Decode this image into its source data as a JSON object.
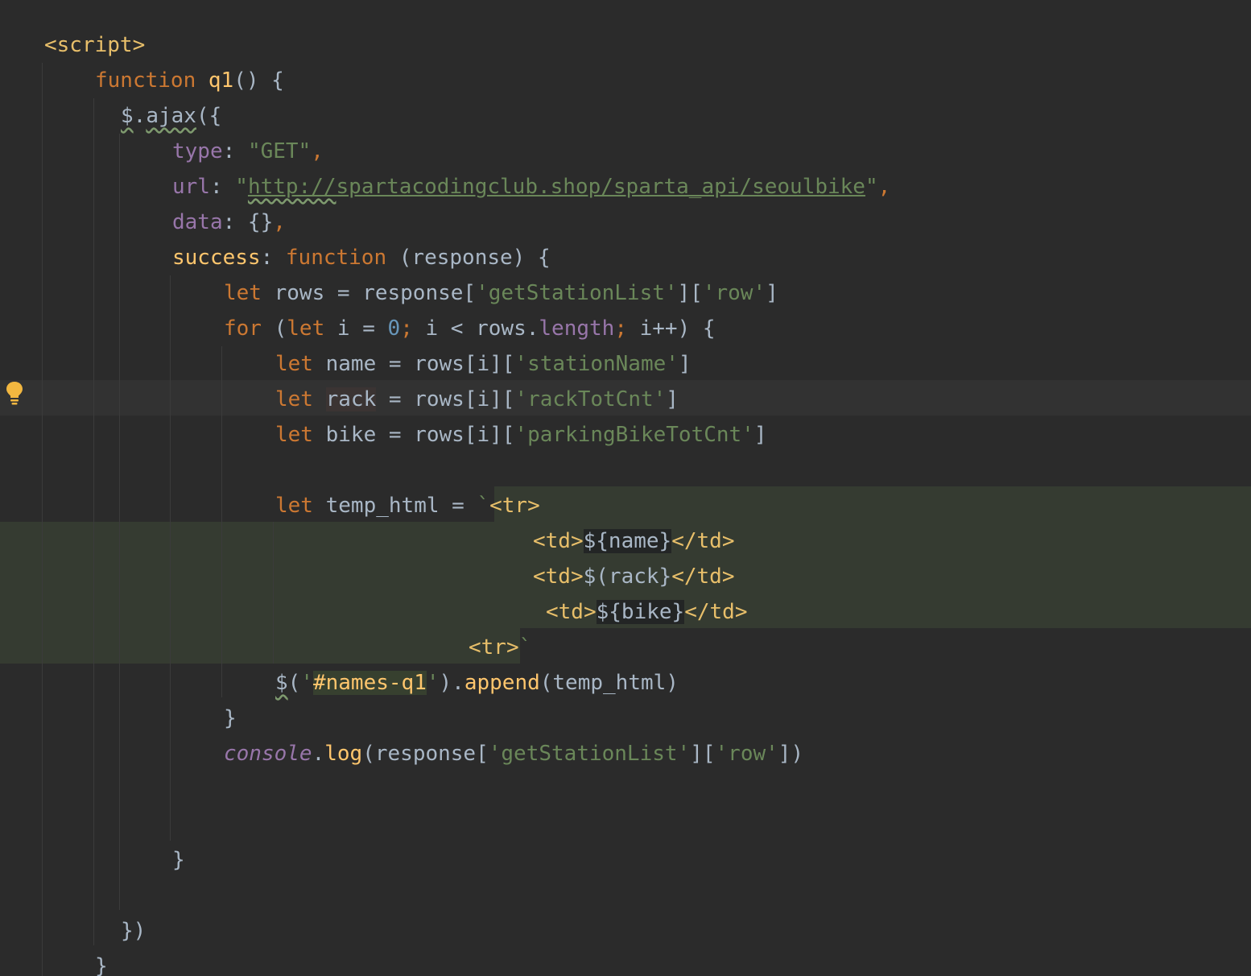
{
  "editor": {
    "lines": [
      "<script>",
      "function q1() {",
      "$.ajax({",
      "type: \"GET\",",
      "url: \"http://spartacodingclub.shop/sparta_api/seoulbike\",",
      "data: {},",
      "success: function (response) {",
      "let rows = response['getStationList']['row']",
      "for (let i = 0; i < rows.length; i++) {",
      "let name = rows[i]['stationName']",
      "let rack = rows[i]['rackTotCnt']",
      "let bike = rows[i]['parkingBikeTotCnt']",
      "",
      "let temp_html = `<tr>",
      "<td>${name}</td>",
      "<td>$(rack}</td>",
      "<td>${bike}</td>",
      "<tr>`",
      "$('#names-q1').append(temp_html)",
      "}",
      "console.log(response['getStationList']['row'])",
      "",
      "",
      "}",
      "",
      "})",
      "}"
    ],
    "intention_icon": "lightbulb-icon",
    "colors": {
      "background": "#2b2b2b",
      "keyword": "#cc7832",
      "function": "#ffc66d",
      "string": "#6a8759",
      "number": "#6897bb",
      "property": "#9876aa",
      "text": "#a9b7c6",
      "tag": "#e8bf6a"
    }
  }
}
